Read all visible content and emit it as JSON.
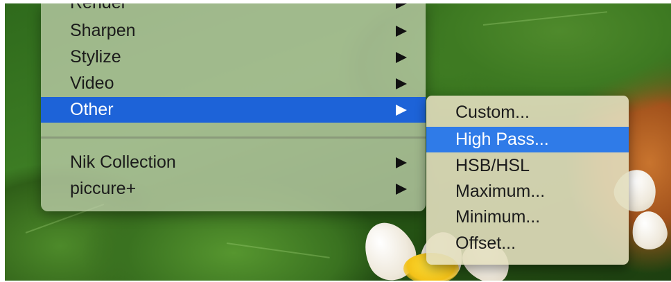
{
  "menu": {
    "items": [
      {
        "label": "Render",
        "has_submenu": true
      },
      {
        "label": "Sharpen",
        "has_submenu": true
      },
      {
        "label": "Stylize",
        "has_submenu": true
      },
      {
        "label": "Video",
        "has_submenu": true
      },
      {
        "label": "Other",
        "has_submenu": true,
        "selected": true
      },
      {
        "label": "Nik Collection",
        "has_submenu": true
      },
      {
        "label": "piccure+",
        "has_submenu": true
      }
    ]
  },
  "submenu": {
    "parent": "Other",
    "items": [
      {
        "label": "Custom..."
      },
      {
        "label": "High Pass...",
        "selected": true
      },
      {
        "label": "HSB/HSL"
      },
      {
        "label": "Maximum..."
      },
      {
        "label": "Minimum..."
      },
      {
        "label": "Offset..."
      }
    ]
  },
  "colors": {
    "selection": "#1d63d8",
    "submenu_selection": "#2f7be8"
  },
  "icons": {
    "submenu_arrow": "triangle-right-icon"
  }
}
